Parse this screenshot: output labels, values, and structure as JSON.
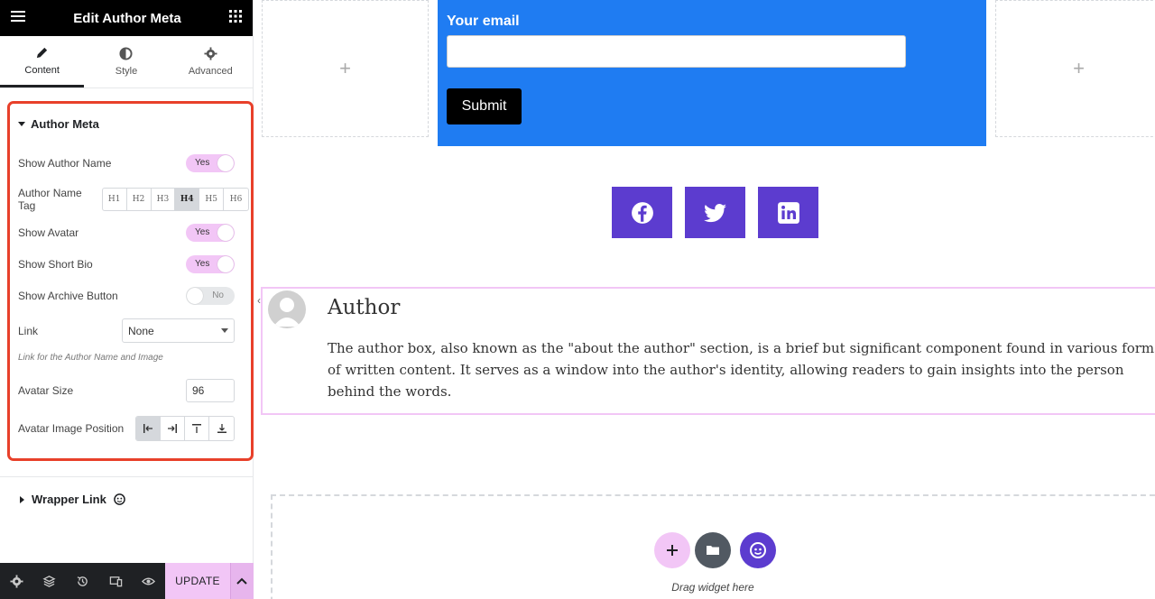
{
  "panel": {
    "title": "Edit Author Meta",
    "tabs": [
      {
        "label": "Content",
        "icon": "pencil-icon",
        "active": true
      },
      {
        "label": "Style",
        "icon": "half-circle-icon"
      },
      {
        "label": "Advanced",
        "icon": "gear-icon"
      }
    ],
    "section_title": "Author Meta",
    "controls": {
      "show_author_name": {
        "label": "Show Author Name",
        "value": "Yes"
      },
      "author_name_tag": {
        "label": "Author Name Tag",
        "options": [
          "H1",
          "H2",
          "H3",
          "H4",
          "H5",
          "H6"
        ],
        "selected": "H4"
      },
      "show_avatar": {
        "label": "Show Avatar",
        "value": "Yes"
      },
      "show_short_bio": {
        "label": "Show Short Bio",
        "value": "Yes"
      },
      "show_archive_button": {
        "label": "Show Archive Button",
        "value": "No"
      },
      "link": {
        "label": "Link",
        "value": "None",
        "help": "Link for the Author Name and Image"
      },
      "avatar_size": {
        "label": "Avatar Size",
        "value": "96"
      },
      "avatar_image_position": {
        "label": "Avatar Image Position"
      }
    },
    "wrapper_link": "Wrapper Link",
    "update_label": "UPDATE",
    "accent": "#f2c6f6",
    "highlight": "#e8402a"
  },
  "canvas": {
    "form": {
      "label": "Your email",
      "button": "Submit",
      "bg": "#1f7cf2"
    },
    "share_buttons": [
      {
        "name": "facebook",
        "icon": "facebook-icon"
      },
      {
        "name": "twitter",
        "icon": "twitter-icon"
      },
      {
        "name": "linkedin",
        "icon": "linkedin-icon"
      }
    ],
    "author": {
      "name": "Author",
      "bio": "The author box, also known as the \"about the author\" section, is a brief but significant component found in various forms of written content. It serves as a window into the author's identity, allowing readers to gain insights into the person behind the words."
    },
    "drop_zone_text": "Drag widget here"
  }
}
